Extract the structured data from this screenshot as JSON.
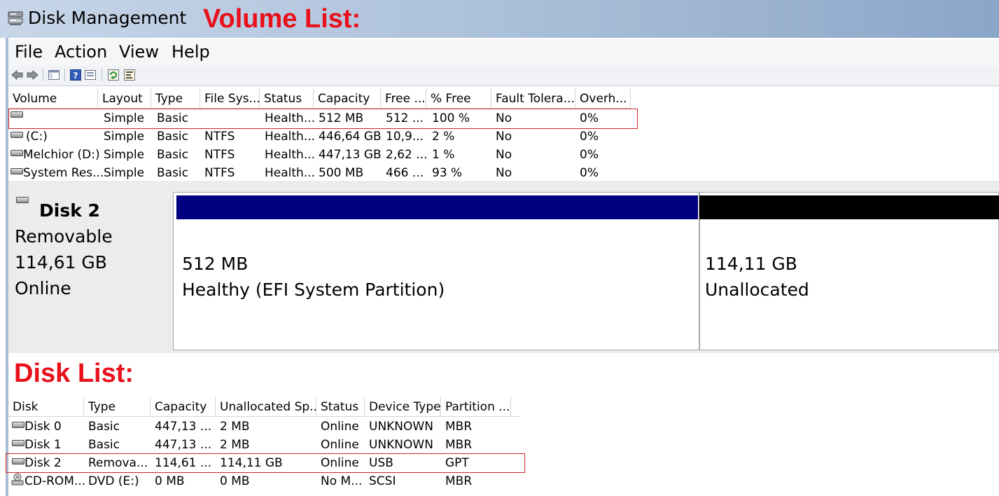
{
  "window": {
    "title": "Disk Management"
  },
  "annotations": {
    "volume_list": "Volume List:",
    "disk_list": "Disk List:"
  },
  "menu": [
    "File",
    "Action",
    "View",
    "Help"
  ],
  "toolbar_icons": [
    "back-arrow-icon",
    "forward-arrow-icon",
    "console-tree-icon",
    "help-icon",
    "refresh-icon",
    "properties-icon"
  ],
  "volume_list": {
    "columns": [
      "Volume",
      "Layout",
      "Type",
      "File Sys...",
      "Status",
      "Capacity",
      "Free ...",
      "% Free",
      "Fault Tolera...",
      "Overh..."
    ],
    "rows": [
      [
        "",
        "Simple",
        "Basic",
        "",
        "Health...",
        "512 MB",
        "512 ...",
        "100 %",
        "No",
        "0%"
      ],
      [
        "(C:)",
        "Simple",
        "Basic",
        "NTFS",
        "Health...",
        "446,64 GB",
        "10,9...",
        "2 %",
        "No",
        "0%"
      ],
      [
        "Melchior (D:)",
        "Simple",
        "Basic",
        "NTFS",
        "Health...",
        "447,13 GB",
        "2,62 ...",
        "1 %",
        "No",
        "0%"
      ],
      [
        "System Res...",
        "Simple",
        "Basic",
        "NTFS",
        "Health...",
        "500 MB",
        "466 ...",
        "93 %",
        "No",
        "0%"
      ]
    ]
  },
  "disk_panel": {
    "name": "Disk 2",
    "kind": "Removable",
    "size": "114,61 GB",
    "state": "Online",
    "partitions": [
      {
        "size": "512 MB",
        "status": "Healthy (EFI System Partition)",
        "bar_color": "#000080"
      },
      {
        "size": "114,11 GB",
        "status": "Unallocated",
        "bar_color": "#000000"
      }
    ]
  },
  "disk_list": {
    "columns": [
      "Disk",
      "Type",
      "Capacity",
      "Unallocated Sp...",
      "Status",
      "Device Type",
      "Partition ..."
    ],
    "rows": [
      [
        "Disk 0",
        "Basic",
        "447,13 ...",
        "2 MB",
        "Online",
        "UNKNOWN",
        "MBR"
      ],
      [
        "Disk 1",
        "Basic",
        "447,13 ...",
        "2 MB",
        "Online",
        "UNKNOWN",
        "MBR"
      ],
      [
        "Disk 2",
        "Remova...",
        "114,61 ...",
        "114,11 GB",
        "Online",
        "USB",
        "GPT"
      ],
      [
        "CD-ROM...",
        "DVD (E:)",
        "0 MB",
        "0 MB",
        "No M...",
        "SCSI",
        "MBR"
      ]
    ]
  },
  "colors": {
    "annotation": "#e8101a",
    "highlight_box": "#d4232b",
    "efi_bar": "#000080",
    "unallocated_bar": "#000000"
  }
}
